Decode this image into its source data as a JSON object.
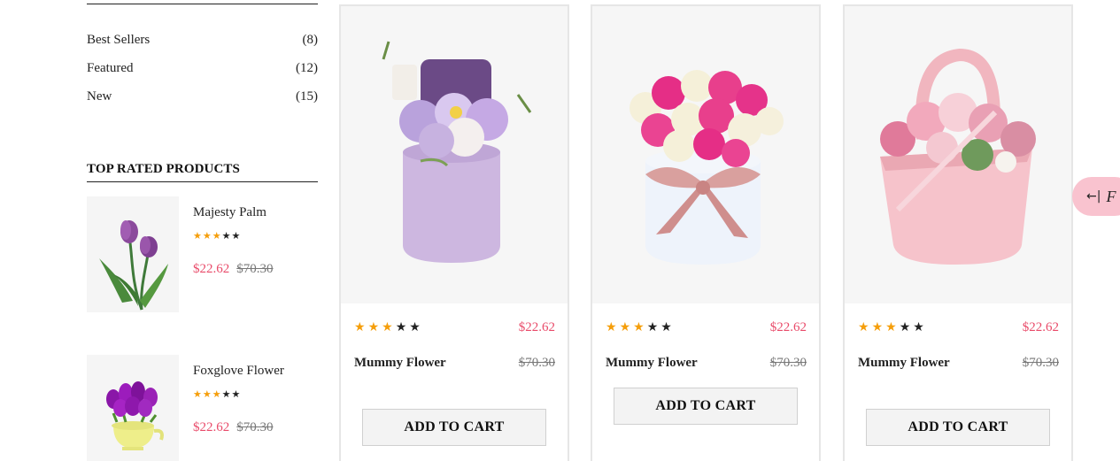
{
  "categories": [
    {
      "label": "Best Sellers",
      "count": "(8)"
    },
    {
      "label": "Featured",
      "count": "(12)"
    },
    {
      "label": "New",
      "count": "(15)"
    }
  ],
  "top_rated": {
    "heading": "TOP RATED PRODUCTS",
    "items": [
      {
        "name": "Majesty Palm",
        "price": "$22.62",
        "old_price": "$70.30",
        "rating": 3,
        "max_rating": 5
      },
      {
        "name": "Foxglove Flower",
        "price": "$22.62",
        "old_price": "$70.30",
        "rating": 3,
        "max_rating": 5
      }
    ]
  },
  "products": [
    {
      "name": "Mummy Flower",
      "price": "$22.62",
      "old_price": "$70.30",
      "rating": 3,
      "max_rating": 5,
      "button": "ADD TO CART"
    },
    {
      "name": "Mummy Flower",
      "price": "$22.62",
      "old_price": "$70.30",
      "rating": 3,
      "max_rating": 5,
      "button": "ADD TO CART"
    },
    {
      "name": "Mummy Flower",
      "price": "$22.62",
      "old_price": "$70.30",
      "rating": 3,
      "max_rating": 5,
      "button": "ADD TO CART"
    }
  ],
  "float_tab": {
    "icon": "arrow-left-bar-icon",
    "letter": "F"
  },
  "colors": {
    "accent_price": "#e94b6a",
    "star": "#f59e0b",
    "float_tab": "#f9c3cf"
  }
}
